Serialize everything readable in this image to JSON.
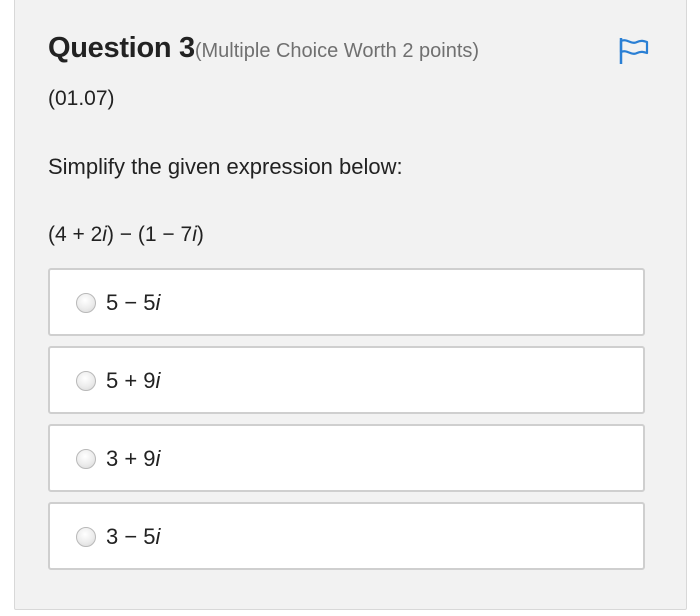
{
  "question": {
    "title": "Question 3",
    "meta": "(Multiple Choice Worth 2 points)",
    "code": "(01.07)",
    "prompt": "Simplify the given expression below:",
    "expression": "(4 + 2i) − (1 − 7i)"
  },
  "flag": {
    "icon": "flag-icon",
    "color": "#2a7fd4"
  },
  "options": [
    {
      "label": "5 − 5i",
      "selected": false
    },
    {
      "label": "5 + 9i",
      "selected": false
    },
    {
      "label": "3 + 9i",
      "selected": false
    },
    {
      "label": "3 − 5i",
      "selected": false
    }
  ]
}
